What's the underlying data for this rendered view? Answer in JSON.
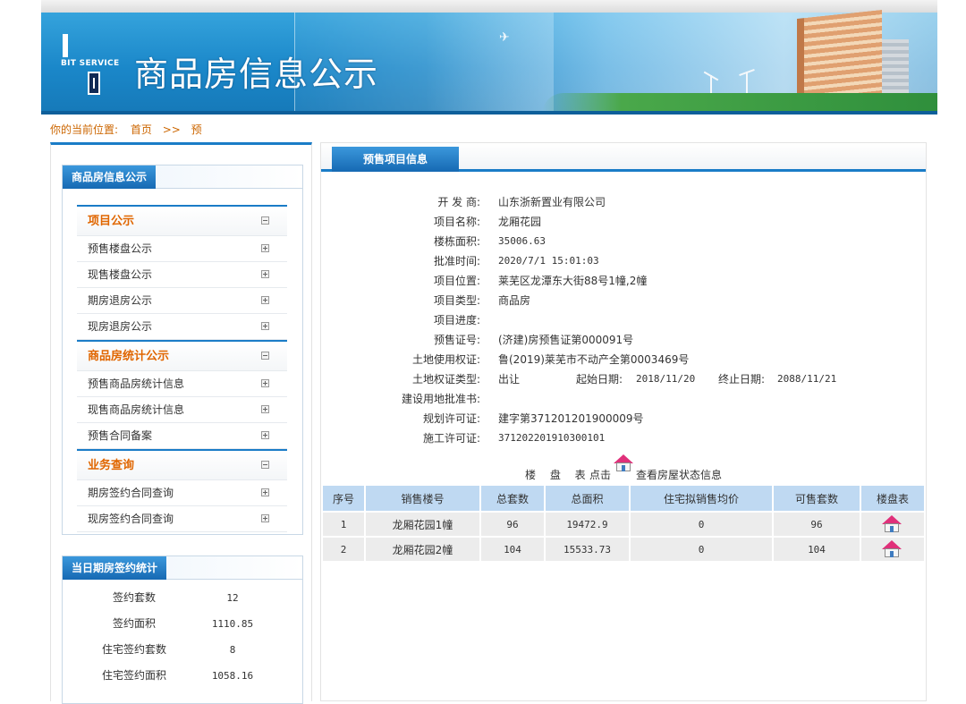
{
  "banner": {
    "logo_text": "BIT SERVICE",
    "title": "商品房信息公示"
  },
  "breadcrumb": {
    "prefix": "你的当前位置:",
    "home": "首页",
    "separator": ">>",
    "current": "预"
  },
  "sidebar": {
    "menu_box_title": "商品房信息公示",
    "groups": [
      {
        "title": "项目公示",
        "items": [
          "预售楼盘公示",
          "现售楼盘公示",
          "期房退房公示",
          "现房退房公示"
        ]
      },
      {
        "title": "商品房统计公示",
        "items": [
          "预售商品房统计信息",
          "现售商品房统计信息",
          "预售合同备案"
        ]
      },
      {
        "title": "业务查询",
        "items": [
          "期房签约合同查询",
          "现房签约合同查询"
        ]
      }
    ],
    "stats_box_title": "当日期房签约统计",
    "stats": [
      {
        "label": "签约套数",
        "value": "12"
      },
      {
        "label": "签约面积",
        "value": "1110.85"
      },
      {
        "label": "住宅签约套数",
        "value": "8"
      },
      {
        "label": "住宅签约面积",
        "value": "1058.16"
      }
    ]
  },
  "main": {
    "tab_title": "预售项目信息",
    "info": {
      "developer": {
        "label": "开 发 商:",
        "value": "山东浙新置业有限公司"
      },
      "project_name": {
        "label": "项目名称:",
        "value": "龙厢花园"
      },
      "building_area": {
        "label": "楼栋面积:",
        "value": "35006.63"
      },
      "approval_time": {
        "label": "批准时间:",
        "value": "2020/7/1 15:01:03"
      },
      "location": {
        "label": "项目位置:",
        "value": "莱芜区龙潭东大街88号1幢,2幢"
      },
      "type": {
        "label": "项目类型:",
        "value": "商品房"
      },
      "progress": {
        "label": "项目进度:",
        "value": ""
      },
      "presale_cert": {
        "label": "预售证号:",
        "value": "(济建)房预售证第000091号"
      },
      "land_right": {
        "label": "土地使用权证:",
        "value": "鲁(2019)莱芜市不动产全第0003469号"
      },
      "land_right_type": {
        "label": "土地权证类型:",
        "value": "出让"
      },
      "start_date": {
        "label": "起始日期:",
        "value": "2018/11/20"
      },
      "end_date": {
        "label": "终止日期:",
        "value": "2088/11/21"
      },
      "land_use_cert": {
        "label": "建设用地批准书:",
        "value": ""
      },
      "planning_permit": {
        "label": "规划许可证:",
        "value": "建字第371201201900009号"
      },
      "construction_permit": {
        "label": "施工许可证:",
        "value": "371202201910300101"
      }
    },
    "panbiao": {
      "label": "楼 盘 表",
      "click": "点击",
      "hint": "查看房屋状态信息"
    },
    "table": {
      "headers": [
        "序号",
        "销售楼号",
        "总套数",
        "总面积",
        "住宅拟销售均价",
        "可售套数",
        "楼盘表"
      ],
      "rows": [
        [
          "1",
          "龙厢花园1幢",
          "96",
          "19472.9",
          "0",
          "96"
        ],
        [
          "2",
          "龙厢花园2幢",
          "104",
          "15533.73",
          "0",
          "104"
        ]
      ]
    }
  },
  "colors": {
    "accent_blue": "#1a7cc7",
    "menu_orange": "#e06600",
    "crumb_orange": "#cc6600",
    "table_header": "#bfd9f2",
    "table_cell": "#ececec"
  }
}
